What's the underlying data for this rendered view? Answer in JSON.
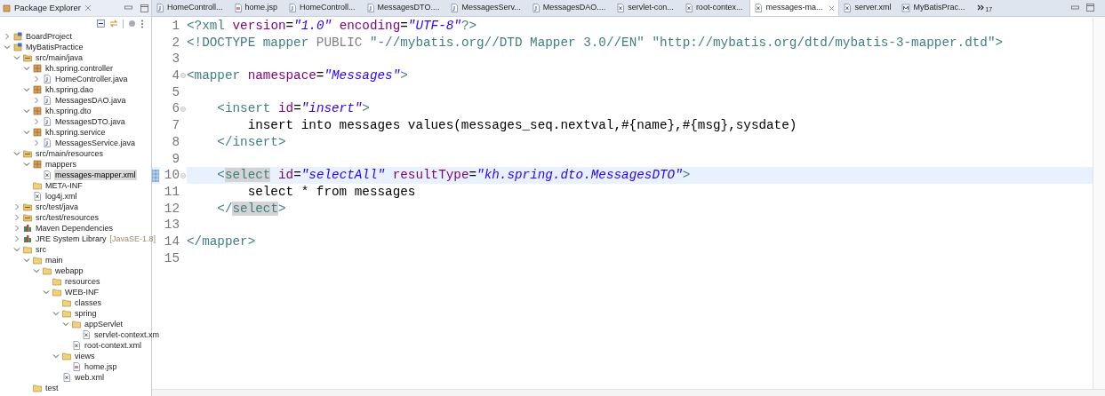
{
  "explorer": {
    "title": "Package Explorer",
    "tree": [
      {
        "label": "BoardProject",
        "kind": "project",
        "expanded": false,
        "selected": false
      },
      {
        "label": "MyBatisPractice",
        "kind": "project",
        "expanded": true,
        "selected": false,
        "children": [
          {
            "label": "src/main/java",
            "kind": "source-folder",
            "expanded": true,
            "selected": false,
            "children": [
              {
                "label": "kh.spring.controller",
                "kind": "package",
                "expanded": true,
                "selected": false,
                "children": [
                  {
                    "label": "HomeController.java",
                    "kind": "java",
                    "expanded": false,
                    "selected": false
                  }
                ]
              },
              {
                "label": "kh.spring.dao",
                "kind": "package",
                "expanded": true,
                "selected": false,
                "children": [
                  {
                    "label": "MessagesDAO.java",
                    "kind": "java",
                    "expanded": false,
                    "selected": false
                  }
                ]
              },
              {
                "label": "kh.spring.dto",
                "kind": "package",
                "expanded": true,
                "selected": false,
                "children": [
                  {
                    "label": "MessagesDTO.java",
                    "kind": "java",
                    "expanded": false,
                    "selected": false
                  }
                ]
              },
              {
                "label": "kh.spring.service",
                "kind": "package",
                "expanded": true,
                "selected": false,
                "children": [
                  {
                    "label": "MessagesService.java",
                    "kind": "java",
                    "expanded": false,
                    "selected": false
                  }
                ]
              }
            ]
          },
          {
            "label": "src/main/resources",
            "kind": "source-folder",
            "expanded": true,
            "selected": false,
            "children": [
              {
                "label": "mappers",
                "kind": "package",
                "expanded": true,
                "selected": false,
                "children": [
                  {
                    "label": "messages-mapper.xml",
                    "kind": "xml",
                    "selected": true
                  }
                ]
              },
              {
                "label": "META-INF",
                "kind": "folder",
                "selected": false
              },
              {
                "label": "log4j.xml",
                "kind": "xml",
                "selected": false
              }
            ]
          },
          {
            "label": "src/test/java",
            "kind": "source-folder",
            "expanded": false,
            "selected": false
          },
          {
            "label": "src/test/resources",
            "kind": "source-folder",
            "expanded": false,
            "selected": false
          },
          {
            "label": "Maven Dependencies",
            "kind": "library",
            "expanded": false,
            "selected": false
          },
          {
            "label": "JRE System Library",
            "decoration": "[JavaSE-1.8]",
            "kind": "library",
            "expanded": false,
            "selected": false
          },
          {
            "label": "src",
            "kind": "folder",
            "expanded": true,
            "selected": false,
            "children": [
              {
                "label": "main",
                "kind": "folder",
                "expanded": true,
                "selected": false,
                "children": [
                  {
                    "label": "webapp",
                    "kind": "folder",
                    "expanded": true,
                    "selected": false,
                    "children": [
                      {
                        "label": "resources",
                        "kind": "folder",
                        "selected": false
                      },
                      {
                        "label": "WEB-INF",
                        "kind": "folder",
                        "expanded": true,
                        "selected": false,
                        "children": [
                          {
                            "label": "classes",
                            "kind": "folder",
                            "selected": false
                          },
                          {
                            "label": "spring",
                            "kind": "folder",
                            "expanded": true,
                            "selected": false,
                            "children": [
                              {
                                "label": "appServlet",
                                "kind": "folder",
                                "expanded": true,
                                "selected": false,
                                "children": [
                                  {
                                    "label": "servlet-context.xm",
                                    "kind": "xml",
                                    "selected": false
                                  }
                                ]
                              },
                              {
                                "label": "root-context.xml",
                                "kind": "xml",
                                "selected": false
                              }
                            ]
                          },
                          {
                            "label": "views",
                            "kind": "folder",
                            "expanded": true,
                            "selected": false,
                            "children": [
                              {
                                "label": "home.jsp",
                                "kind": "jsp",
                                "selected": false
                              }
                            ]
                          },
                          {
                            "label": "web.xml",
                            "kind": "xml",
                            "selected": false
                          }
                        ]
                      }
                    ]
                  }
                ]
              },
              {
                "label": "test",
                "kind": "folder",
                "selected": false
              }
            ]
          }
        ]
      }
    ]
  },
  "tabs": [
    {
      "label": "HomeControll...",
      "kind": "java",
      "selected": false
    },
    {
      "label": "home.jsp",
      "kind": "jsp",
      "selected": false
    },
    {
      "label": "HomeControll...",
      "kind": "java",
      "selected": false
    },
    {
      "label": "MessagesDTO....",
      "kind": "java",
      "selected": false
    },
    {
      "label": "MessagesServ...",
      "kind": "java",
      "selected": false
    },
    {
      "label": "MessagesDAO....",
      "kind": "java",
      "selected": false
    },
    {
      "label": "servlet-con...",
      "kind": "xml",
      "selected": false
    },
    {
      "label": "root-contex...",
      "kind": "xml",
      "selected": false
    },
    {
      "label": "messages-ma...",
      "kind": "xml",
      "selected": true
    },
    {
      "label": "server.xml",
      "kind": "xml",
      "selected": false
    },
    {
      "label": "MyBatisPrac...",
      "kind": "mybatis",
      "selected": false
    }
  ],
  "tabs_overflow": "17",
  "editor": {
    "lines": [
      {
        "number": "1",
        "tokens": [
          {
            "kind": "tag",
            "text": "<?xml"
          },
          {
            "kind": "attr",
            "text": " version"
          },
          {
            "kind": "punct",
            "text": "="
          },
          {
            "kind": "string",
            "text": "\"1.0\""
          },
          {
            "kind": "attr",
            "text": " encoding"
          },
          {
            "kind": "punct",
            "text": "="
          },
          {
            "kind": "string",
            "text": "\"UTF-8\""
          },
          {
            "kind": "tag",
            "text": "?>"
          }
        ]
      },
      {
        "number": "2",
        "tokens": [
          {
            "kind": "tag",
            "text": "<!DOCTYPE mapper"
          },
          {
            "kind": "keyword",
            "text": " PUBLIC"
          },
          {
            "kind": "tag",
            "text": " \"-//mybatis.org//DTD Mapper 3.0//EN\""
          },
          {
            "kind": "tag",
            "text": " \"http://mybatis.org/dtd/mybatis-3-mapper.dtd\""
          },
          {
            "kind": "tag",
            "text": ">"
          }
        ]
      },
      {
        "number": "3"
      },
      {
        "number": "4",
        "fold": true,
        "tokens": [
          {
            "kind": "tag",
            "text": "<mapper"
          },
          {
            "kind": "attr",
            "text": " namespace"
          },
          {
            "kind": "punct",
            "text": "="
          },
          {
            "kind": "string",
            "text": "\"Messages\""
          },
          {
            "kind": "tag",
            "text": ">"
          }
        ]
      },
      {
        "number": "5"
      },
      {
        "number": "6",
        "fold": true,
        "tokens": [
          {
            "kind": "tag",
            "text": "    <insert"
          },
          {
            "kind": "attr",
            "text": " id"
          },
          {
            "kind": "punct",
            "text": "="
          },
          {
            "kind": "string",
            "text": "\"insert\""
          },
          {
            "kind": "tag",
            "text": ">"
          }
        ]
      },
      {
        "number": "7",
        "tokens": [
          {
            "kind": "text",
            "text": "        insert into messages values(messages_seq.nextval,#{name},#{msg},sysdate)"
          }
        ]
      },
      {
        "number": "8",
        "tokens": [
          {
            "kind": "tag",
            "text": "    </insert>"
          }
        ]
      },
      {
        "number": "9"
      },
      {
        "number": "10",
        "fold": true,
        "current": true,
        "tokens": [
          {
            "kind": "tag",
            "text": "    <"
          },
          {
            "kind": "matched-tag",
            "text": "select"
          },
          {
            "kind": "attr",
            "text": " id"
          },
          {
            "kind": "punct",
            "text": "="
          },
          {
            "kind": "string",
            "text": "\"selectAll\""
          },
          {
            "kind": "attr",
            "text": " resultType"
          },
          {
            "kind": "punct",
            "text": "="
          },
          {
            "kind": "string",
            "text": "\"kh.spring.dto.MessagesDTO\""
          },
          {
            "kind": "tag",
            "text": ">"
          }
        ]
      },
      {
        "number": "11",
        "tokens": [
          {
            "kind": "text",
            "text": "        select * from messages"
          }
        ]
      },
      {
        "number": "12",
        "tokens": [
          {
            "kind": "tag",
            "text": "    </"
          },
          {
            "kind": "matched-tag",
            "text": "select"
          },
          {
            "kind": "tag",
            "text": ">"
          }
        ]
      },
      {
        "number": "13"
      },
      {
        "number": "14",
        "tokens": [
          {
            "kind": "tag",
            "text": "</mapper>"
          }
        ]
      },
      {
        "number": "15"
      }
    ]
  }
}
